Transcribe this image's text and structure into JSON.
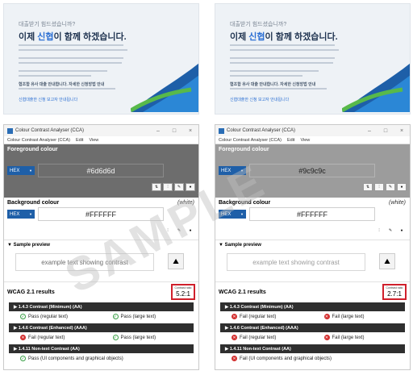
{
  "banner": {
    "question": "대출받기 힘드셨습니까?",
    "headline_pre": "이제 ",
    "headline_highlight": "신협",
    "headline_post": "이 함께 하겠습니다.",
    "subheading": "협조합 유사 대출 안내합니다. 자세한 신청방법 안내",
    "link": "신협대출한 신청 보고자 안내됩니다"
  },
  "app": {
    "title": "Colour Contrast Analyser (CCA)",
    "menu": [
      "Colour Contrast Analyser (CCA)",
      "Edit",
      "View"
    ],
    "foreground_label": "Foreground colour",
    "background_label": "Background colour",
    "background_name": "(white)",
    "format": "HEX",
    "background_value": "#FFFFFF",
    "sample_label": "▼ Sample preview",
    "sample_text": "example text showing contrast",
    "results_label": "WCAG 2.1 results",
    "ratio_label": "Contrast ratio"
  },
  "left": {
    "foreground_value": "#6d6d6d",
    "foreground_bg": "#6d6d6d",
    "sample_color": "#6d6d6d",
    "ratio": "5.2:1",
    "criteria": [
      {
        "title": "▶ 1.4.3 Contrast (Minimum) (AA)",
        "results": [
          {
            "status": "pass",
            "text": "Pass (regular text)"
          },
          {
            "status": "pass",
            "text": "Pass (large text)"
          }
        ]
      },
      {
        "title": "▶ 1.4.6 Contrast (Enhanced) (AAA)",
        "results": [
          {
            "status": "fail",
            "text": "Fail (regular text)"
          },
          {
            "status": "pass",
            "text": "Pass (large text)"
          }
        ]
      },
      {
        "title": "▶ 1.4.11 Non-text Contrast (AA)",
        "results": [
          {
            "status": "pass",
            "text": "Pass (UI components and graphical objects)"
          }
        ]
      }
    ]
  },
  "right": {
    "foreground_value": "#9c9c9c",
    "foreground_bg": "#9c9c9c",
    "sample_color": "#9c9c9c",
    "ratio": "2.7:1",
    "criteria": [
      {
        "title": "▶ 1.4.3 Contrast (Minimum) (AA)",
        "results": [
          {
            "status": "fail",
            "text": "Fail (regular text)"
          },
          {
            "status": "fail",
            "text": "Fail (large text)"
          }
        ]
      },
      {
        "title": "▶ 1.4.6 Contrast (Enhanced) (AAA)",
        "results": [
          {
            "status": "fail",
            "text": "Fail (regular text)"
          },
          {
            "status": "fail",
            "text": "Fail (large text)"
          }
        ]
      },
      {
        "title": "▶ 1.4.11 Non-text Contrast (AA)",
        "results": [
          {
            "status": "fail",
            "text": "Fail (UI components and graphical objects)"
          }
        ]
      }
    ]
  },
  "icons": {
    "swap": "⇅",
    "sliders": "⫶",
    "eyedropper": "✎",
    "info": "●",
    "sample_button": "image-compare-icon"
  },
  "watermark": "SAMPLE",
  "colors": {
    "format_blue": "#1e5fa8",
    "pass": "#3aa047",
    "fail": "#d32f2f",
    "ratio_box": "#d0202c",
    "criterion_bar": "#2f2f2f"
  }
}
